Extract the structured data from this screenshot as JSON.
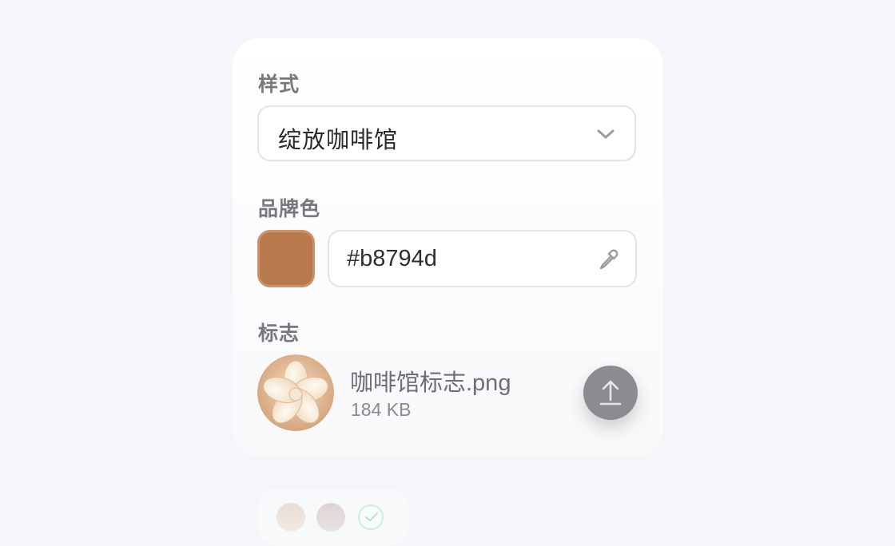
{
  "style_section": {
    "label": "样式",
    "selected": "绽放咖啡馆",
    "chevron_icon": "chevron-down-icon"
  },
  "brand_color_section": {
    "label": "品牌色",
    "hex_value": "#b8794d",
    "swatch_color": "#b8794d",
    "eyedropper_icon": "eyedropper-icon"
  },
  "logo_section": {
    "label": "标志",
    "file_name": "咖啡馆标志.png",
    "file_size": "184 KB",
    "upload_icon": "upload-icon"
  },
  "dock": {
    "items": [
      "swatch-beige",
      "swatch-mauve",
      "check-icon"
    ]
  }
}
